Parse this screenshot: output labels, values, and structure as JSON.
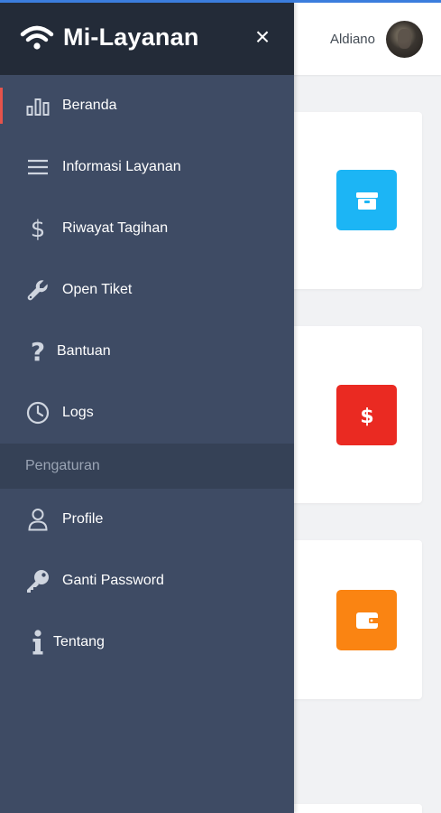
{
  "header": {
    "user_name": "Aldiano"
  },
  "sidebar": {
    "brand_title": "Mi-Layanan",
    "close_label": "×",
    "items": [
      {
        "label": "Beranda",
        "icon": "bar-chart-icon",
        "active": true
      },
      {
        "label": "Informasi Layanan",
        "icon": "menu-lines-icon"
      },
      {
        "label": "Riwayat Tagihan",
        "icon": "dollar-icon"
      },
      {
        "label": "Open Tiket",
        "icon": "wrench-icon"
      },
      {
        "label": "Bantuan",
        "icon": "question-icon"
      },
      {
        "label": "Logs",
        "icon": "clock-icon"
      }
    ],
    "section_label": "Pengaturan",
    "settings_items": [
      {
        "label": "Profile",
        "icon": "user-icon"
      },
      {
        "label": "Ganti Password",
        "icon": "key-icon"
      },
      {
        "label": "Tentang",
        "icon": "info-icon"
      }
    ]
  },
  "cards": [
    {
      "icon": "box-icon",
      "color": "#1cb5f5"
    },
    {
      "icon": "dollar-icon",
      "color": "#ea2a22"
    },
    {
      "icon": "wallet-icon",
      "color": "#fa8412"
    }
  ],
  "colors": {
    "sidebar_bg": "#3e4b64",
    "brand_bg": "#232b38",
    "section_bg": "#354156",
    "active_marker": "#e5534b"
  }
}
